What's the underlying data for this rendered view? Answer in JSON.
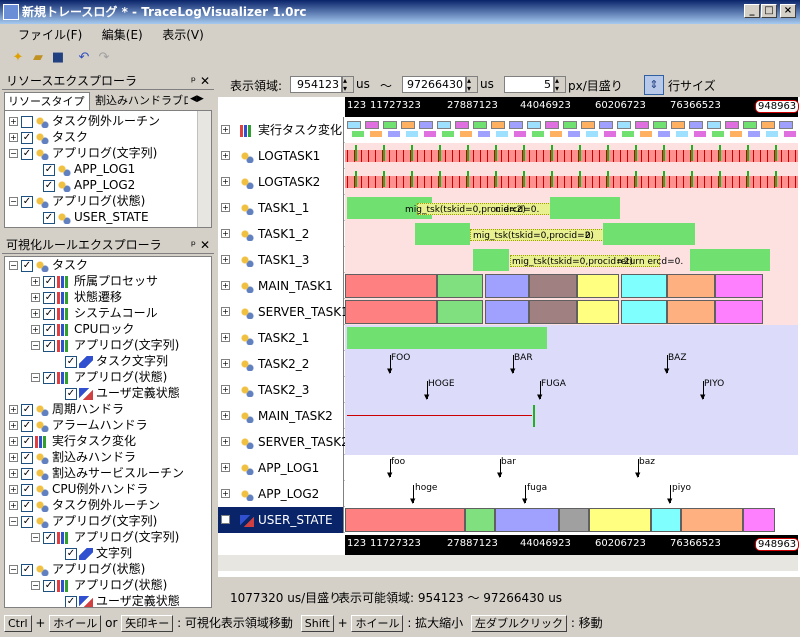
{
  "window": {
    "title": "新規トレースログ * - TraceLogVisualizer 1.0rc",
    "min": "_",
    "max": "□",
    "close": "×"
  },
  "menu": [
    "ファイル(F)",
    "編集(E)",
    "表示(V)"
  ],
  "resource_panel": {
    "title": "リソースエクスプローラ",
    "tabs": [
      "リソースタイプ別",
      "割込みハンドラブロ"
    ],
    "items": [
      "タスク例外ルーチン",
      "タスク",
      "アプリログ(文字列)",
      "APP_LOG1",
      "APP_LOG2",
      "アプリログ(状態)",
      "USER_STATE"
    ]
  },
  "rule_panel": {
    "title": "可視化ルールエクスプローラ",
    "items": [
      "タスク",
      "所属プロセッサ",
      "状態遷移",
      "システムコール",
      "CPUロック",
      "アプリログ(文字列)",
      "タスク文字列",
      "アプリログ(状態)",
      "ユーザ定義状態",
      "周期ハンドラ",
      "アラームハンドラ",
      "実行タスク変化",
      "割込みハンドラ",
      "割込みサービスルーチン",
      "CPU例外ハンドラ",
      "タスク例外ルーチン",
      "アプリログ(文字列)",
      "アプリログ(文字列)",
      "文字列",
      "アプリログ(状態)",
      "アプリログ(状態)",
      "ユーザ定義状態"
    ]
  },
  "viewbar": {
    "label": "表示領域:",
    "from": "954123",
    "unit1": "us",
    "tilde": "〜",
    "to": "97266430",
    "unit2": "us",
    "scale": "5",
    "scale_unit": "px/目盛り",
    "rowsize": "行サイズ"
  },
  "ruler": {
    "ticks": [
      "123",
      "11727323",
      "27887123",
      "44046923",
      "60206723",
      "76366523"
    ],
    "end": "948963"
  },
  "rows": [
    "実行タスク変化",
    "LOGTASK1",
    "LOGTASK2",
    "TASK1_1",
    "TASK1_2",
    "TASK1_3",
    "MAIN_TASK1",
    "SERVER_TASK1",
    "TASK2_1",
    "TASK2_2",
    "TASK2_3",
    "MAIN_TASK2",
    "SERVER_TASK2",
    "APP_LOG1",
    "APP_LOG2",
    "USER_STATE"
  ],
  "annotations": {
    "mig1": "mig_tsk(tskid=0,procid=2)",
    "ret1": "n ercd=0.",
    "mig2": "mig_tsk(tskid=0,procid=2)",
    "ret2": "0.",
    "mig3": "mig_tsk(tskid=0,procid=2)",
    "ret3": "return ercd=0.",
    "foo": "FOO",
    "bar": "BAR",
    "baz": "BAZ",
    "hoge": "HOGE",
    "fuga": "FUGA",
    "piyo": "PIYO",
    "foo2": "foo",
    "bar2": "bar",
    "baz2": "baz",
    "hoge2": "hoge",
    "fuga2": "fuga",
    "piyo2": "piyo"
  },
  "status": {
    "scale": "1077320 us/目盛り",
    "range": "表示可能領域: 954123 〜 97266430 us"
  },
  "hint": {
    "k1": "Ctrl",
    "p1": "+",
    "k2": "ホイール",
    "or": "or",
    "k3": "矢印キー",
    "t1": ": 可視化表示領域移動",
    "k4": "Shift",
    "p2": "+",
    "k5": "ホイール",
    "t2": ": 拡大縮小",
    "k6": "左ダブルクリック",
    "t3": ": 移動"
  }
}
